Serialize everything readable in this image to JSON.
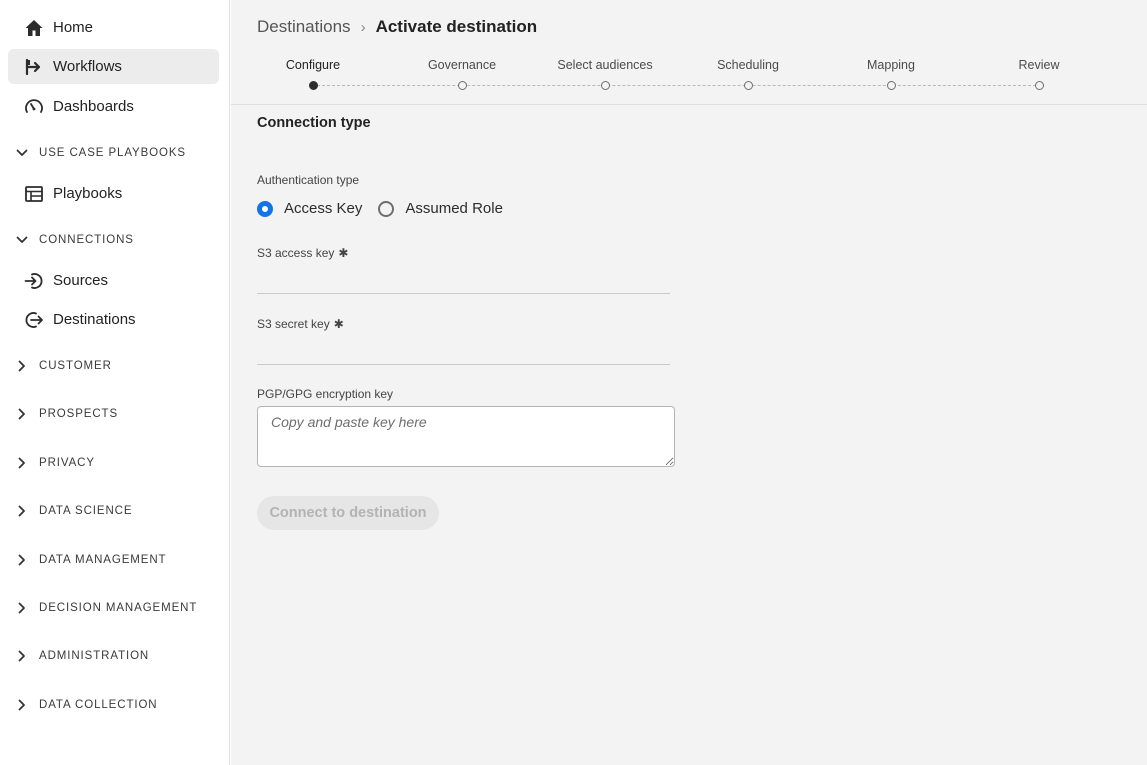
{
  "sidebar": {
    "nav": [
      {
        "label": "Home",
        "icon": "home-icon"
      },
      {
        "label": "Workflows",
        "icon": "workflows-icon"
      },
      {
        "label": "Dashboards",
        "icon": "dashboard-gauge-icon"
      }
    ],
    "sections": [
      {
        "label": "USE CASE PLAYBOOKS",
        "expanded": true
      },
      {
        "label": "CONNECTIONS",
        "expanded": true
      },
      {
        "label": "CUSTOMER",
        "expanded": false
      },
      {
        "label": "PROSPECTS",
        "expanded": false
      },
      {
        "label": "PRIVACY",
        "expanded": false
      },
      {
        "label": "DATA SCIENCE",
        "expanded": false
      },
      {
        "label": "DATA MANAGEMENT",
        "expanded": false
      },
      {
        "label": "DECISION MANAGEMENT",
        "expanded": false
      },
      {
        "label": "ADMINISTRATION",
        "expanded": false
      },
      {
        "label": "DATA COLLECTION",
        "expanded": false
      }
    ],
    "playbooks_item": {
      "label": "Playbooks",
      "icon": "table-icon"
    },
    "connection_items": [
      {
        "label": "Sources",
        "icon": "login-arrow-icon"
      },
      {
        "label": "Destinations",
        "icon": "logout-arrow-icon"
      }
    ],
    "active_item": "Workflows"
  },
  "breadcrumb": {
    "parent": "Destinations",
    "separator": "›",
    "current": "Activate destination"
  },
  "stepper": {
    "steps": [
      "Configure",
      "Governance",
      "Select audiences",
      "Scheduling",
      "Mapping",
      "Review"
    ],
    "current_index": 0
  },
  "form": {
    "section_title": "Connection type",
    "auth_label": "Authentication type",
    "auth_options": [
      "Access Key",
      "Assumed Role"
    ],
    "auth_selected": "Access Key",
    "access_key_label": "S3 access key",
    "secret_key_label": "S3 secret key",
    "required_mark": "✱",
    "access_key_value": "",
    "secret_key_value": "",
    "encryption_label": "PGP/GPG encryption key",
    "encryption_placeholder": "Copy and paste key here",
    "submit_label": "Connect to destination"
  },
  "colors": {
    "accent": "#1473e6",
    "active_nav_bg": "#ececec",
    "main_bg": "#f3f3f3"
  }
}
